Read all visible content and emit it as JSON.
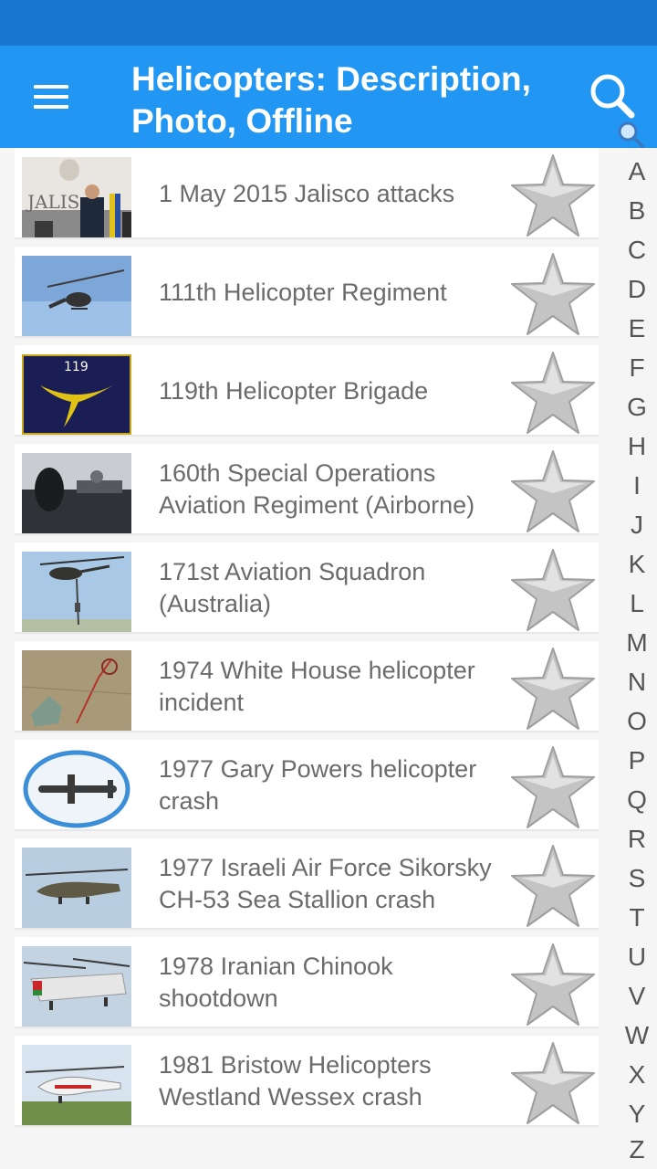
{
  "app_bar": {
    "title": "Helicopters: Description, Photo, Offline",
    "menu_icon": "hamburger-menu-icon",
    "search_icon": "search-icon",
    "background": "#2196f3",
    "status_bar_color": "#1976d2"
  },
  "list": {
    "items": [
      {
        "title": "1 May 2015 Jalisco attacks",
        "thumbnail": "press-conference-photo",
        "favorite": false
      },
      {
        "title": "111th Helicopter Regiment",
        "thumbnail": "helicopter-in-sky-photo",
        "favorite": false
      },
      {
        "title": "119th Helicopter Brigade",
        "thumbnail": "brigade-emblem-photo",
        "favorite": false
      },
      {
        "title": "160th Special Operations Aviation Regiment (Airborne)",
        "thumbnail": "soldier-aircraft-photo",
        "favorite": false
      },
      {
        "title": "171st Aviation Squadron (Australia)",
        "thumbnail": "black-hawk-photo",
        "favorite": false
      },
      {
        "title": "1974 White House helicopter incident",
        "thumbnail": "map-photo",
        "favorite": false
      },
      {
        "title": "1977 Gary Powers helicopter crash",
        "thumbnail": "aircraft-silhouette-photo",
        "favorite": false
      },
      {
        "title": "1977 Israeli Air Force Sikorsky CH-53 Sea Stallion crash",
        "thumbnail": "sea-stallion-photo",
        "favorite": false
      },
      {
        "title": "1978 Iranian Chinook shootdown",
        "thumbnail": "chinook-photo",
        "favorite": false
      },
      {
        "title": "1981 Bristow Helicopters Westland Wessex crash",
        "thumbnail": "wessex-photo",
        "favorite": false
      }
    ],
    "favorite_icon": "star-icon"
  },
  "alphabet_index": [
    "A",
    "B",
    "C",
    "D",
    "E",
    "F",
    "G",
    "H",
    "I",
    "J",
    "K",
    "L",
    "M",
    "N",
    "O",
    "P",
    "Q",
    "R",
    "S",
    "T",
    "U",
    "V",
    "W",
    "X",
    "Y",
    "Z"
  ]
}
